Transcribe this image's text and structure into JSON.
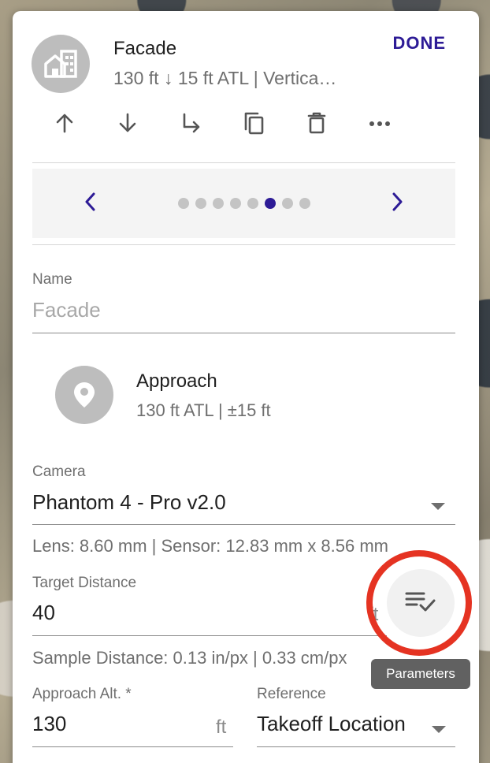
{
  "header": {
    "title": "Facade",
    "subtitle": "130 ft ↓ 15 ft ATL | Vertica…",
    "done_label": "DONE",
    "avatar_icon": "facade-building-icon"
  },
  "toolbar": {
    "items": [
      {
        "name": "move-up",
        "icon": "arrow-up-icon"
      },
      {
        "name": "move-down",
        "icon": "arrow-down-icon"
      },
      {
        "name": "move-into",
        "icon": "subdirectory-arrow-icon"
      },
      {
        "name": "duplicate",
        "icon": "copy-icon"
      },
      {
        "name": "delete",
        "icon": "trash-icon"
      },
      {
        "name": "more",
        "icon": "more-horizontal-icon"
      }
    ]
  },
  "pager": {
    "page_count": 8,
    "active_index": 5
  },
  "name_field": {
    "label": "Name",
    "placeholder": "Facade"
  },
  "approach": {
    "icon": "location-pin-icon",
    "title": "Approach",
    "subtitle": "130 ft ATL | ±15 ft"
  },
  "camera": {
    "label": "Camera",
    "value": "Phantom 4 - Pro v2.0",
    "helper": "Lens: 8.60 mm | Sensor: 12.83 mm x 8.56 mm"
  },
  "target_distance": {
    "label": "Target Distance",
    "value": "40",
    "unit": "ft",
    "helper": "Sample Distance: 0.13 in/px | 0.33 cm/px"
  },
  "approach_alt": {
    "label": "Approach Alt. *",
    "value": "130",
    "unit": "ft"
  },
  "reference": {
    "label": "Reference",
    "value": "Takeoff Location"
  },
  "parameters_button": {
    "icon": "playlist-check-icon",
    "tooltip": "Parameters"
  },
  "colors": {
    "accent": "#2d1b96",
    "highlight_ring": "#e53322",
    "tooltip_bg": "#616161"
  }
}
